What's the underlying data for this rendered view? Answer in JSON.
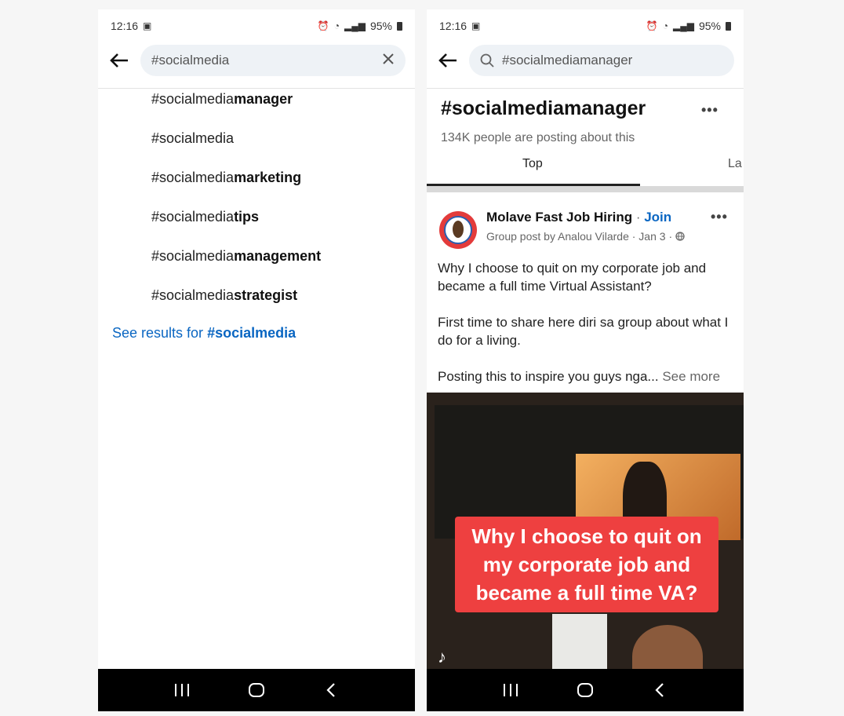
{
  "status_bar": {
    "time": "12:16",
    "battery": "95%"
  },
  "left": {
    "search": {
      "value": "#socialmedia"
    },
    "suggestions": [
      {
        "prefix": "#socialmedia",
        "bold": "manager"
      },
      {
        "prefix": "#socialmedia",
        "bold": ""
      },
      {
        "prefix": "#socialmedia",
        "bold": "marketing"
      },
      {
        "prefix": "#socialmedia",
        "bold": "tips"
      },
      {
        "prefix": "#socialmedia",
        "bold": "management"
      },
      {
        "prefix": "#socialmedia",
        "bold": "strategist"
      }
    ],
    "see_results": {
      "prefix": "See results for ",
      "bold": "#socialmedia"
    }
  },
  "right": {
    "search": {
      "value": "#socialmediamanager"
    },
    "hashtag": {
      "title": "#socialmediamanager",
      "subtitle": "134K people are posting about this"
    },
    "tabs": [
      "Top",
      "La"
    ],
    "post": {
      "author": "Molave Fast Job Hiring",
      "separator": " · ",
      "join": "Join",
      "meta": "Group post by Analou Vilarde · Jan 3 ·",
      "paragraphs": [
        "Why I choose to quit on my corporate job and became a full time Virtual Assistant?",
        "First time to share here diri sa group about what I do for a living."
      ],
      "last_line": "Posting this to inspire you guys nga...",
      "see_more": "See more",
      "video_caption": "Why I choose to quit on my corporate job and became a full time VA?"
    }
  },
  "icons": {
    "back": "back-arrow-icon",
    "clear": "close-icon",
    "search": "search-icon",
    "more": "more-icon",
    "globe": "globe-icon",
    "tiktok": "tiktok-icon"
  },
  "colors": {
    "link": "#0a66c2",
    "caption_bg": "#ee4040",
    "navbar": "#000000"
  }
}
